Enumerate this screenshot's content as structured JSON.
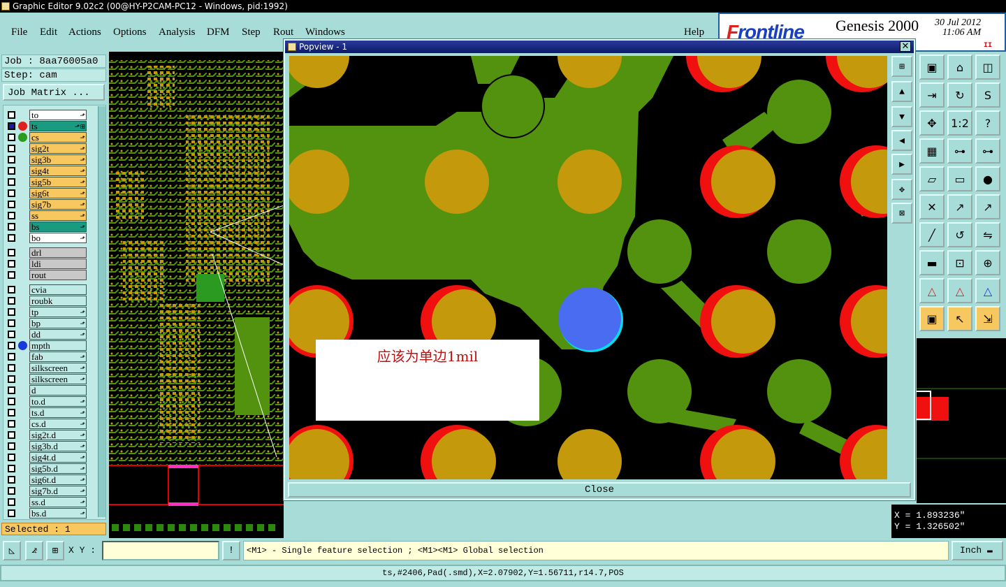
{
  "window": {
    "title": "Graphic Editor 9.02c2 (00@HY-P2CAM-PC12 - Windows, pid:1992)"
  },
  "menu": {
    "items": [
      "File",
      "Edit",
      "Actions",
      "Options",
      "Analysis",
      "DFM",
      "Step",
      "Rout",
      "Windows"
    ],
    "help": "Help"
  },
  "brand": {
    "logo_prefix": "F",
    "logo_rest": "rontline",
    "product": "Genesis 2000",
    "date": "30 Jul 2012",
    "time": "11:06 AM",
    "pause": "II"
  },
  "job": {
    "job_label": "Job : 8aa76005a0",
    "step_label": "Step: cam",
    "matrix_button": "Job Matrix ..."
  },
  "layers": {
    "group1": [
      {
        "name": "to",
        "color": "#ffffff",
        "ind": "",
        "mark": "⬏"
      },
      {
        "name": "ts",
        "color": "#1a9a80",
        "ind": "#e02020",
        "mark": "⬏⊞"
      },
      {
        "name": "cs",
        "color": "#f8c860",
        "ind": "#2a9a20",
        "mark": "⬏"
      },
      {
        "name": "sig2t",
        "color": "#f8c860",
        "ind": "",
        "mark": "⬏"
      },
      {
        "name": "sig3b",
        "color": "#f8c860",
        "ind": "",
        "mark": "⬏"
      },
      {
        "name": "sig4t",
        "color": "#f8c860",
        "ind": "",
        "mark": "⬏"
      },
      {
        "name": "sig5b",
        "color": "#f8c860",
        "ind": "",
        "mark": "⬏"
      },
      {
        "name": "sig6t",
        "color": "#f8c860",
        "ind": "",
        "mark": "⬏"
      },
      {
        "name": "sig7b",
        "color": "#f8c860",
        "ind": "",
        "mark": "⬏"
      },
      {
        "name": "ss",
        "color": "#f8c860",
        "ind": "",
        "mark": "⬏"
      },
      {
        "name": "bs",
        "color": "#1a9a80",
        "ind": "",
        "mark": "⬏"
      },
      {
        "name": "bo",
        "color": "#ffffff",
        "ind": "",
        "mark": "⬏"
      }
    ],
    "group2": [
      {
        "name": "drl",
        "color": "#c8c8c8",
        "ind": "",
        "mark": ""
      },
      {
        "name": "ldi",
        "color": "#c8c8c8",
        "ind": "",
        "mark": ""
      },
      {
        "name": "rout",
        "color": "#c8c8c8",
        "ind": "",
        "mark": ""
      }
    ],
    "group3": [
      {
        "name": "cvia",
        "color": "#bfeae6",
        "ind": "",
        "mark": ""
      },
      {
        "name": "roubk",
        "color": "#bfeae6",
        "ind": "",
        "mark": ""
      },
      {
        "name": "tp",
        "color": "#bfeae6",
        "ind": "",
        "mark": "⬏"
      },
      {
        "name": "bp",
        "color": "#bfeae6",
        "ind": "",
        "mark": "⬏"
      },
      {
        "name": "dd",
        "color": "#bfeae6",
        "ind": "",
        "mark": "⬏"
      },
      {
        "name": "mpth",
        "color": "#bfeae6",
        "ind": "#1a3ad8",
        "mark": ""
      },
      {
        "name": "fab",
        "color": "#bfeae6",
        "ind": "",
        "mark": "⬏"
      },
      {
        "name": "silkscreen",
        "color": "#bfeae6",
        "ind": "",
        "mark": "⬏"
      },
      {
        "name": "silkscreen",
        "color": "#bfeae6",
        "ind": "",
        "mark": "⬏"
      },
      {
        "name": "d",
        "color": "#bfeae6",
        "ind": "",
        "mark": ""
      },
      {
        "name": "to.d",
        "color": "#bfeae6",
        "ind": "",
        "mark": "⬏"
      },
      {
        "name": "ts.d",
        "color": "#bfeae6",
        "ind": "",
        "mark": "⬏"
      },
      {
        "name": "cs.d",
        "color": "#bfeae6",
        "ind": "",
        "mark": "⬏"
      },
      {
        "name": "sig2t.d",
        "color": "#bfeae6",
        "ind": "",
        "mark": "⬏"
      },
      {
        "name": "sig3b.d",
        "color": "#bfeae6",
        "ind": "",
        "mark": "⬏"
      },
      {
        "name": "sig4t.d",
        "color": "#bfeae6",
        "ind": "",
        "mark": "⬏"
      },
      {
        "name": "sig5b.d",
        "color": "#bfeae6",
        "ind": "",
        "mark": "⬏"
      },
      {
        "name": "sig6t.d",
        "color": "#bfeae6",
        "ind": "",
        "mark": "⬏"
      },
      {
        "name": "sig7b.d",
        "color": "#bfeae6",
        "ind": "",
        "mark": "⬏"
      },
      {
        "name": "ss.d",
        "color": "#bfeae6",
        "ind": "",
        "mark": "⬏"
      },
      {
        "name": "bs.d",
        "color": "#bfeae6",
        "ind": "",
        "mark": "⬏"
      }
    ]
  },
  "selected": "Selected : 1",
  "popview": {
    "title": "Popview - 1",
    "close_button": "Close",
    "annotation": "应该为单边1mil"
  },
  "coords": {
    "x": "X = 1.893236\"",
    "y": "Y = 1.326502\""
  },
  "status": {
    "xy_label": "X Y :",
    "xy_value": "",
    "message": "<M1> - Single feature selection ; <M1><M1> Global selection",
    "units": "Inch"
  },
  "info": "ts,#2406,Pad(.smd),X=2.07902,Y=1.56711,r14.7,POS",
  "colors": {
    "copper_green": "#52920f",
    "pad_gold": "#c49a0c",
    "red_ring": "#f01010",
    "selected_blue": "#4a6cf0"
  },
  "toolbar_icons": [
    "screen-icon",
    "house-icon",
    "window-icon",
    "arrow-right-icon",
    "rotate-icon",
    "s-curve-icon",
    "zoom-fit-icon",
    "scale-1-2-icon",
    "help-icon",
    "grid-icon",
    "layers-red-icon",
    "layers-red-icon",
    "shape-icon",
    "ruler-icon",
    "circle-icon",
    "cross-icon",
    "connect-icon",
    "connect-blue-icon",
    "line-icon",
    "arc-icon",
    "split-icon",
    "minus-icon",
    "measure-icon",
    "nodes-icon",
    "triangle-icon",
    "triangle-red-icon",
    "triangle-blue-icon",
    "select-box-icon",
    "select-pointer-icon",
    "select-multi-icon"
  ]
}
